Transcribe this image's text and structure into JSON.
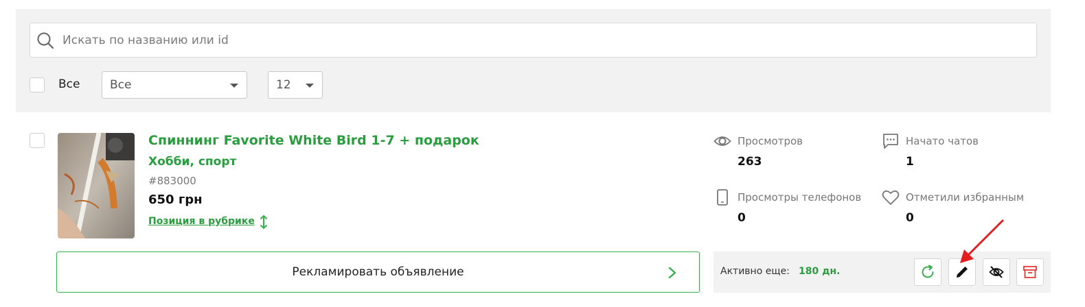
{
  "filters": {
    "search_placeholder": "Искать по названию или id",
    "select_all_label": "Все",
    "status_select": "Все",
    "per_page_select": "12"
  },
  "listing": {
    "title": "Спиннинг Favorite White Bird 1-7 + подарок",
    "category": "Хобби, спорт",
    "id": "#883000",
    "price": "650 грн",
    "position_link": "Позиция в рубрике",
    "stats": {
      "views_label": "Просмотров",
      "views": "263",
      "chats_label": "Начато чатов",
      "chats": "1",
      "phone_views_label": "Просмотры телефонов",
      "phone_views": "0",
      "favorites_label": "Отметили избранным",
      "favorites": "0"
    },
    "promote_label": "Рекламировать объявление",
    "active_label": "Активно еще:",
    "active_days": "180 дн."
  },
  "icons": {
    "search": "search-icon",
    "views": "eye-icon",
    "chats": "chat-icon",
    "phone": "phone-icon",
    "favorites": "heart-icon",
    "promote": "chevron-right-icon",
    "refresh": "refresh-icon",
    "edit": "pencil-icon",
    "hide": "eye-off-icon",
    "archive": "archive-icon"
  },
  "colors": {
    "accent": "#2a9d3f",
    "panel": "#f2f2f2",
    "archive": "#e53935",
    "annotation_arrow": "#e41e1e"
  }
}
